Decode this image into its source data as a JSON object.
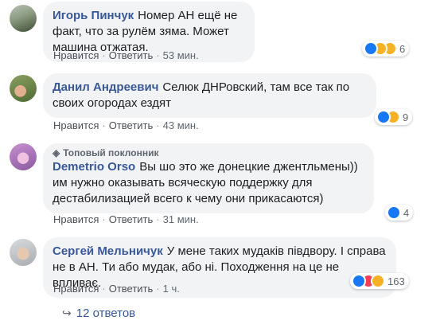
{
  "comments": [
    {
      "author": "Игорь Пинчук",
      "text": "Номер АН ещё не факт, что за рулём зяма. Может машина отжатая.",
      "like_label": "Нравится",
      "reply_label": "Ответить",
      "time": "53 мин.",
      "reaction_count": "6",
      "reactions": [
        "like-icon",
        "haha-icon",
        "sad-icon"
      ],
      "avatar_colors": [
        "#a8b0a0",
        "#5a6b4c"
      ]
    },
    {
      "author": "Данил Андреевич",
      "text": "Селюк ДНРовский, там все так по своих огородах ездят",
      "like_label": "Нравится",
      "reply_label": "Ответить",
      "time": "43 мин.",
      "reaction_count": "9",
      "reactions": [
        "like-icon",
        "haha-icon"
      ],
      "avatar_colors": [
        "#6f8a4a",
        "#d9a07a"
      ]
    },
    {
      "badge": "Топовый поклонник",
      "author": "Demetrio Orso",
      "text": "Вы шо это же донецкие джентльмены)) им нужно оказывать всяческую поддержку для дестабилизацией всего к чему они прикасаются)",
      "like_label": "Нравится",
      "reply_label": "Ответить",
      "time": "31 мин.",
      "reaction_count": "4",
      "reactions": [
        "like-icon"
      ],
      "avatar_colors": [
        "#b07ab8",
        "#e8a8d0"
      ]
    },
    {
      "author": "Сергей Мельничук",
      "text": "У мене таких мудаків півдвору. І справа не в АН. Ти або мудак, або ні. Походження на це не впливає.",
      "like_label": "Нравится",
      "reply_label": "Ответить",
      "time": "1 ч.",
      "reaction_count": "163",
      "reactions": [
        "like-icon",
        "love-icon",
        "haha-icon"
      ],
      "avatar_colors": [
        "#c0c4c8",
        "#e0c8b0"
      ]
    }
  ],
  "replies_link": "12 ответов",
  "colors": {
    "link": "#385898",
    "bubble": "#f2f3f5",
    "like": "#1877f2",
    "love": "#f33e58",
    "haha": "#f7b125"
  }
}
